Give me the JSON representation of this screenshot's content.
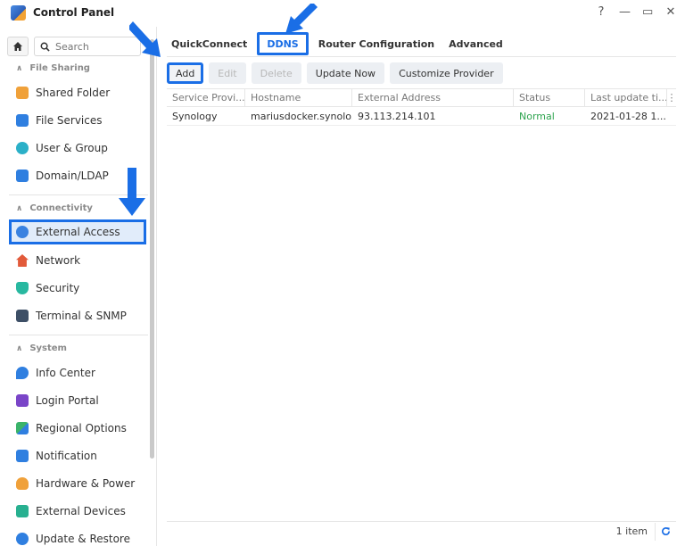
{
  "window": {
    "title": "Control Panel",
    "controls": {
      "help": "?",
      "minimize": "—",
      "maximize": "▭",
      "close": "✕"
    }
  },
  "sidebar": {
    "search_placeholder": "Search",
    "sections": [
      {
        "label": "File Sharing",
        "items": [
          {
            "label": "Shared Folder",
            "icon": "shared-folder-icon",
            "color": "#f0a13a"
          },
          {
            "label": "File Services",
            "icon": "file-services-icon",
            "color": "#2f7fe0"
          },
          {
            "label": "User & Group",
            "icon": "user-group-icon",
            "color": "#2bb0c8"
          },
          {
            "label": "Domain/LDAP",
            "icon": "domain-ldap-icon",
            "color": "#2f7fe0"
          }
        ]
      },
      {
        "label": "Connectivity",
        "items": [
          {
            "label": "External Access",
            "icon": "external-access-icon",
            "color": "#3a82e0",
            "active": true
          },
          {
            "label": "Network",
            "icon": "network-icon",
            "color": "#e25a3a"
          },
          {
            "label": "Security",
            "icon": "security-icon",
            "color": "#28b8a0"
          },
          {
            "label": "Terminal & SNMP",
            "icon": "terminal-icon",
            "color": "#3d4f66"
          }
        ]
      },
      {
        "label": "System",
        "items": [
          {
            "label": "Info Center",
            "icon": "info-center-icon",
            "color": "#2f7fe0"
          },
          {
            "label": "Login Portal",
            "icon": "login-portal-icon",
            "color": "#7a45c8"
          },
          {
            "label": "Regional Options",
            "icon": "regional-options-icon",
            "color": "#3ab36a"
          },
          {
            "label": "Notification",
            "icon": "notification-icon",
            "color": "#2f7fe0"
          },
          {
            "label": "Hardware & Power",
            "icon": "hardware-power-icon",
            "color": "#f0a13a"
          },
          {
            "label": "External Devices",
            "icon": "external-devices-icon",
            "color": "#28b090"
          },
          {
            "label": "Update & Restore",
            "icon": "update-restore-icon",
            "color": "#2f7fe0"
          }
        ]
      }
    ]
  },
  "tabs": [
    {
      "label": "QuickConnect"
    },
    {
      "label": "DDNS",
      "active": true
    },
    {
      "label": "Router Configuration"
    },
    {
      "label": "Advanced"
    }
  ],
  "toolbar": {
    "add": "Add",
    "edit": "Edit",
    "delete": "Delete",
    "update_now": "Update Now",
    "customize_provider": "Customize Provider"
  },
  "grid": {
    "columns": [
      "Service Provi...",
      "Hostname",
      "External Address",
      "Status",
      "Last update ti...",
      "⋮"
    ],
    "rows": [
      [
        "Synology",
        "mariusdocker.synolo...",
        "93.113.214.101",
        "Normal",
        "2021-01-28 1..."
      ]
    ]
  },
  "footer": {
    "count": "1 item"
  },
  "colors": {
    "accent": "#1a6ee6",
    "status_ok": "#2ea44f"
  }
}
